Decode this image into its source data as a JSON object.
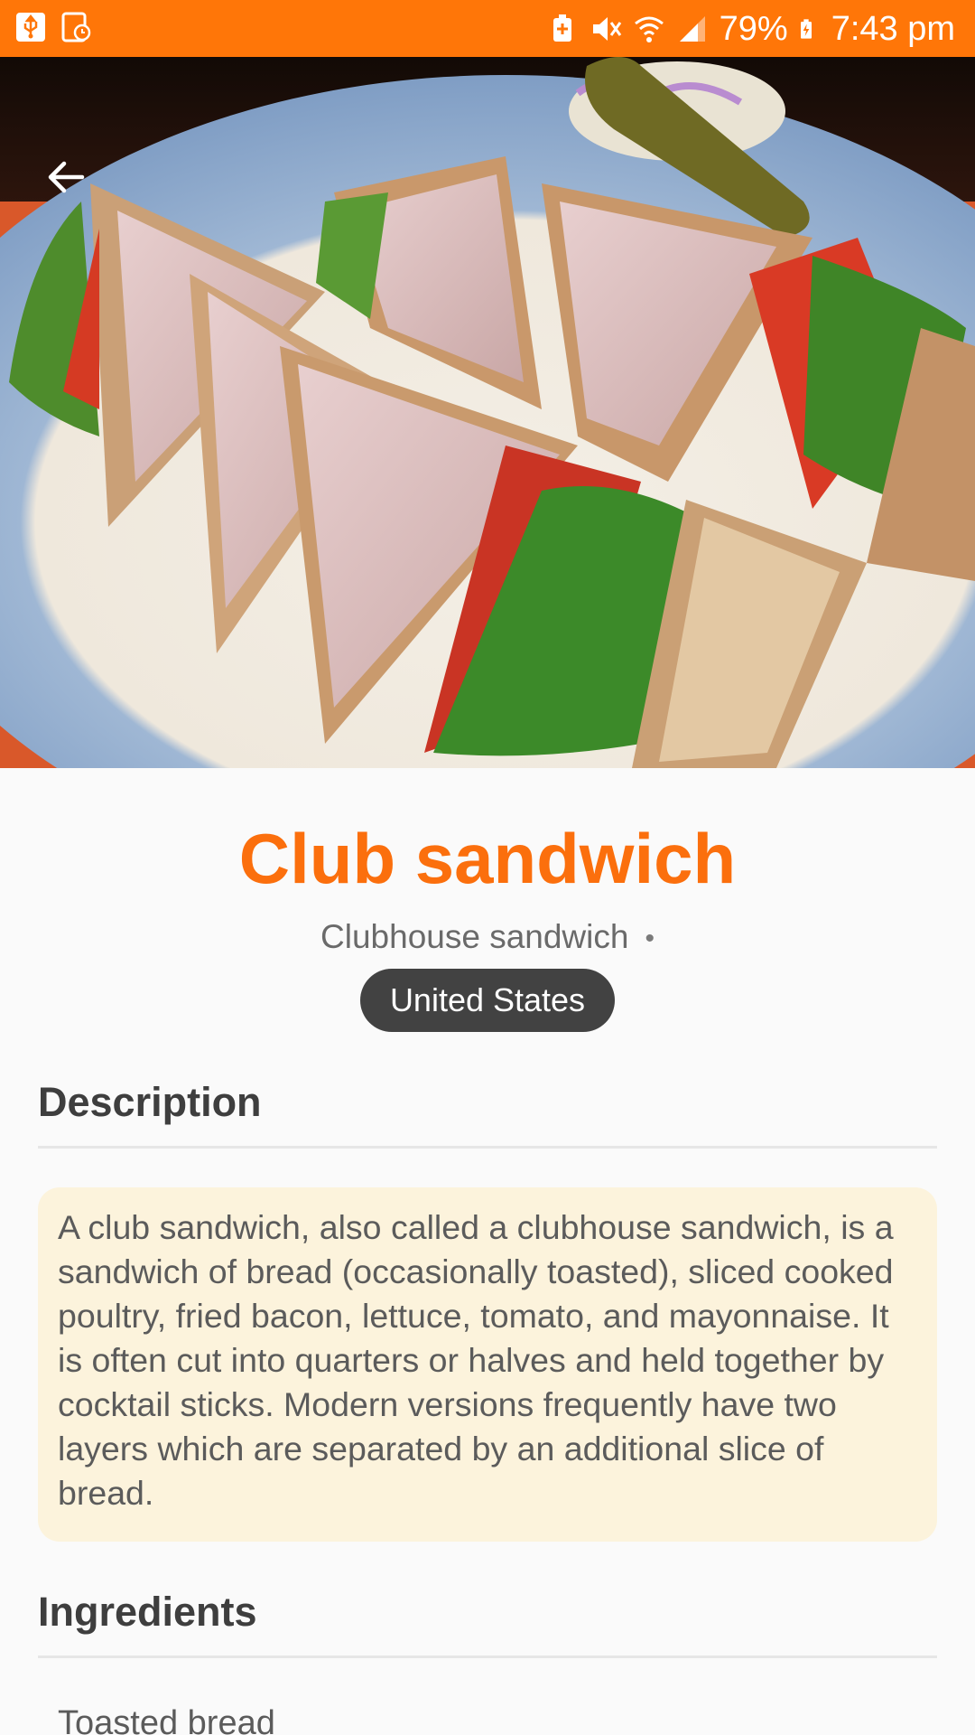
{
  "status_bar": {
    "battery_percent": "79%",
    "time": "7:43 pm",
    "left_icons": [
      "usb-icon",
      "screen-record-icon"
    ],
    "right_icons": [
      "battery-saver-icon",
      "mute-icon",
      "wifi-icon",
      "signal-icon",
      "battery-charging-icon"
    ],
    "background_color": "#ff7608"
  },
  "hero": {
    "image_subject": "club sandwich quarters on a blue and orange plate",
    "back_icon": "arrow-back-icon"
  },
  "dish": {
    "name": "Club sandwich",
    "alt_name": "Clubhouse sandwich",
    "separator": "•",
    "country": "United States"
  },
  "sections": {
    "description_title": "Description",
    "description_text": "A club sandwich, also called a clubhouse sandwich, is a sandwich of bread (occasionally toasted), sliced cooked poultry, fried bacon, lettuce, tomato, and mayonnaise. It is often cut into quarters or halves and held together by cocktail sticks. Modern versions frequently have two layers which are separated by an additional slice of bread.",
    "ingredients_title": "Ingredients",
    "ingredients": [
      "Toasted bread"
    ]
  },
  "colors": {
    "accent": "#fb6f0d",
    "chip": "#424242",
    "card": "#fcf3dc",
    "text": "#5b5b5b",
    "heading": "#3e3e3e"
  }
}
